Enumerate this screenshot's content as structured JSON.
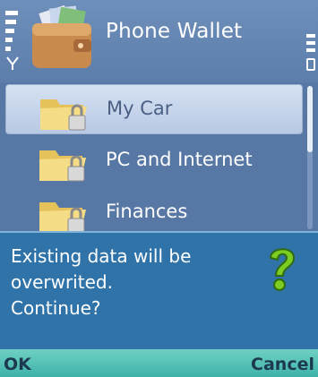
{
  "header": {
    "title": "Phone Wallet",
    "app_icon": "wallet-icon",
    "indicators": [
      "signal-icon",
      "battery-icon"
    ]
  },
  "list": {
    "items": [
      {
        "label": "My Car",
        "icon": "locked-folder-icon",
        "selected": true
      },
      {
        "label": "PC and Internet",
        "icon": "locked-folder-icon",
        "selected": false
      },
      {
        "label": "Finances",
        "icon": "locked-folder-icon",
        "selected": false
      }
    ]
  },
  "dialog": {
    "lines": [
      "Existing data will be",
      "overwrited.",
      "Continue?"
    ],
    "icon": "question-icon"
  },
  "softkeys": {
    "left": "OK",
    "right": "Cancel"
  },
  "colors": {
    "background": "#5a7aa6",
    "dialog": "#2f73a9",
    "softkey_bar": "#3fb2a8",
    "question_mark": "#7dcc22"
  }
}
